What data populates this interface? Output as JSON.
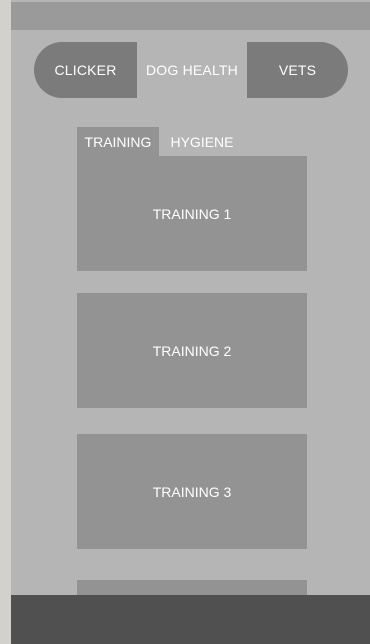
{
  "nav": {
    "items": [
      {
        "label": "CLICKER"
      },
      {
        "label": "DOG HEALTH"
      },
      {
        "label": "VETS"
      }
    ]
  },
  "tabs": {
    "items": [
      {
        "label": "TRAINING",
        "active": true
      },
      {
        "label": "HYGIENE",
        "active": false
      }
    ]
  },
  "cards": [
    {
      "label": "TRAINING 1"
    },
    {
      "label": "TRAINING 2"
    },
    {
      "label": "TRAINING 3"
    },
    {
      "label": ""
    }
  ],
  "colors": {
    "background": "#b5b5b5",
    "top_strip": "#9a9a9a",
    "segment_dark": "#7b7b7b",
    "card": "#939393",
    "bottom_bar": "#505050",
    "text": "#ffffff"
  }
}
